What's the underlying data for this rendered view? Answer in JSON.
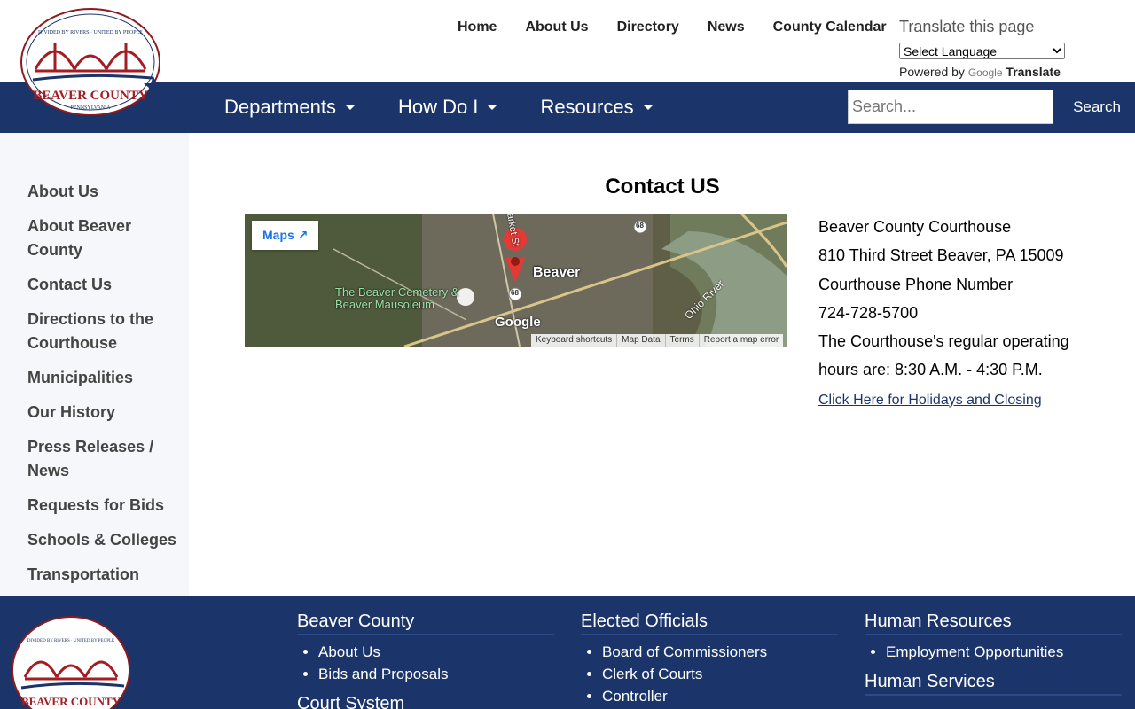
{
  "logo": {
    "arc_text": "DIVIDED BY RIVERS · UNITED BY PEOPLE",
    "name": "BEAVER COUNTY",
    "state": "PENNSYLVANIA"
  },
  "topnav": [
    "Home",
    "About Us",
    "Directory",
    "News",
    "County Calendar"
  ],
  "translate": {
    "label": "Translate this page",
    "select_value": "Select Language",
    "powered_by": "Powered by",
    "google": "Google",
    "translate_word": "Translate"
  },
  "mainnav": {
    "items": [
      "Departments",
      "How Do I",
      "Resources"
    ],
    "search_placeholder": "Search...",
    "search_button": "Search"
  },
  "sidebar": {
    "items": [
      "About Us",
      "About Beaver County",
      "Contact Us",
      "Directions to the Courthouse",
      "Municipalities",
      "Our History",
      "Press Releases / News",
      "Requests for Bids",
      "Schools & Colleges",
      "Transportation"
    ]
  },
  "content": {
    "title": "Contact US",
    "map": {
      "maps_button": "Maps",
      "place": "Beaver",
      "cemetery": "The Beaver Cemetery & Beaver Mausoleum",
      "river": "Ohio River",
      "road_shield": "68",
      "street": "Market St",
      "google": "Google",
      "footer": [
        "Keyboard shortcuts",
        "Map Data",
        "Terms",
        "Report a map error"
      ]
    },
    "lines": [
      "Beaver County Courthouse",
      "810 Third Street Beaver, PA 15009",
      "Courthouse Phone Number",
      "724-728-5700",
      "The Courthouse's regular operating hours are: 8:30 A.M. - 4:30 P.M."
    ],
    "link": "Click Here for Holidays and Closing"
  },
  "footer": {
    "col1": {
      "title": "Beaver County",
      "items": [
        "About Us",
        "Bids and Proposals"
      ],
      "next_title": "Court System"
    },
    "col2": {
      "title": "Elected Officials",
      "items": [
        "Board of Commissioners",
        "Clerk of Courts",
        "Controller"
      ]
    },
    "col3": {
      "title": "Human Resources",
      "items": [
        "Employment Opportunities"
      ],
      "next_title": "Human Services"
    }
  }
}
